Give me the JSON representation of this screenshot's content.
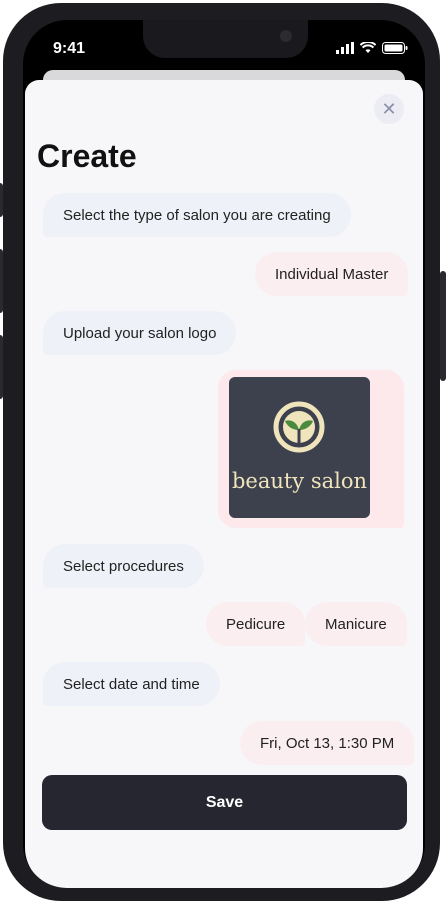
{
  "status": {
    "time": "9:41"
  },
  "sheet": {
    "close_label": "✕",
    "title": "Create",
    "save_label": "Save"
  },
  "chat": {
    "q1": "Select the type of salon you are creating",
    "a1": "Individual Master",
    "q2": "Upload your salon logo",
    "logo_text": "beauty salon",
    "q3": "Select procedures",
    "a3": [
      "Pedicure",
      "Manicure"
    ],
    "q4": "Select date and time",
    "a4": "Fri, Oct 13, 1:30 PM"
  },
  "colors": {
    "frame": "#1d1d21",
    "sheet": "#f7f7f9",
    "question_bubble": "#eef1f7",
    "answer_bubble": "#faeef0",
    "button": "#262631",
    "logo_bg": "#3c414d",
    "logo_accent": "#efe4bc"
  }
}
